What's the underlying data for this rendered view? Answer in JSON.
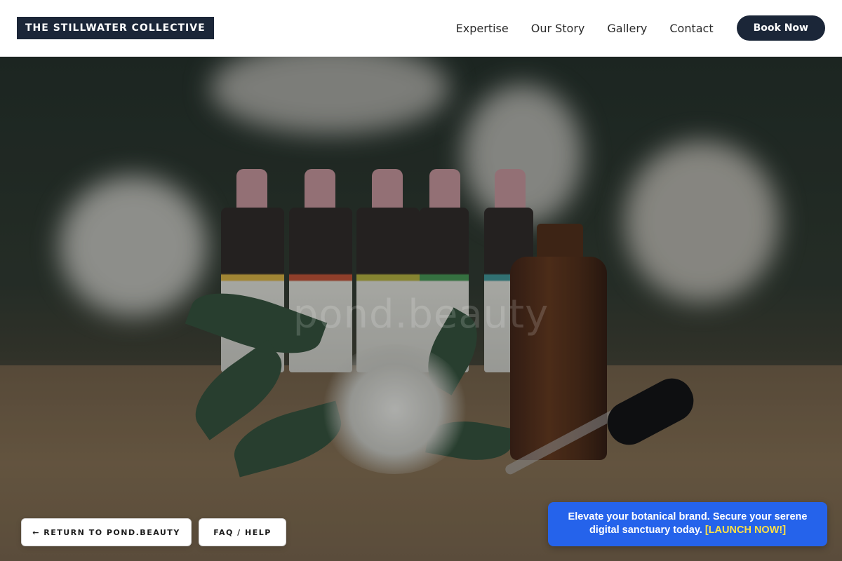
{
  "header": {
    "logo": "THE STILLWATER COLLECTIVE",
    "nav": [
      "Expertise",
      "Our Story",
      "Gallery",
      "Contact"
    ],
    "book_label": "Book Now"
  },
  "hero": {
    "watermark": "pond.beauty"
  },
  "buttons": {
    "return_label": "← RETURN TO POND.BEAUTY",
    "faq_label": "FAQ / HELP"
  },
  "promo": {
    "text": "Elevate your botanical brand. Secure your serene digital sanctuary today.",
    "cta": "[LAUNCH NOW!]",
    "accent": "#2563eb",
    "cta_color": "#fde047"
  },
  "colors": {
    "brand_dark": "#1b2638"
  },
  "icons": {
    "return_arrow": "left-arrow-icon"
  }
}
